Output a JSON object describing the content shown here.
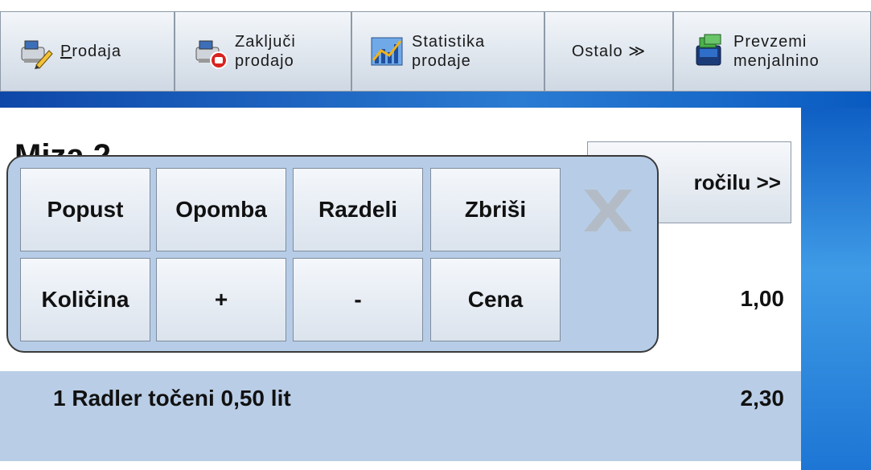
{
  "toolbar": {
    "buttons": [
      {
        "label_pre": "",
        "label_ul": "P",
        "label_post": "rodaja",
        "icon": "register-pencil-icon"
      },
      {
        "label": "Zaključi\nprodajo",
        "icon": "register-stop-icon"
      },
      {
        "label": "Statistika\nprodaje",
        "icon": "chart-icon"
      },
      {
        "label": "Ostalo ≫",
        "icon": ""
      },
      {
        "label": "Prevzemi\nmenjalnino",
        "icon": "cash-register-money-icon"
      }
    ]
  },
  "content": {
    "title_partial": "Miza 2",
    "order_button": "ročilu >>",
    "item_qty": "1,00",
    "selected_item": {
      "text": "1 Radler točeni 0,50 lit",
      "price": "2,30"
    }
  },
  "popup": {
    "row1": [
      "Popust",
      "Opomba",
      "Razdeli",
      "Zbriši"
    ],
    "row2": [
      "Količina",
      "+",
      "-",
      "Cena"
    ]
  },
  "colors": {
    "selected_row": "#b9cde6",
    "popup_bg": "#b7cde7",
    "accent_blue": "#1d76d4"
  }
}
